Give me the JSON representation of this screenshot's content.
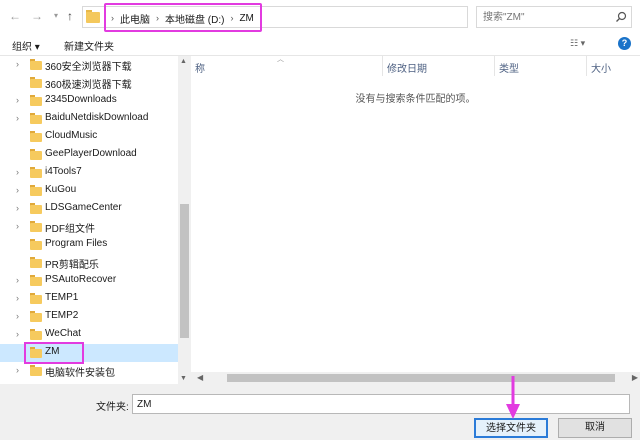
{
  "addressbar": {
    "crumbs": [
      "此电脑",
      "本地磁盘 (D:)",
      "ZM"
    ],
    "search_placeholder": "搜索\"ZM\""
  },
  "toolbar": {
    "organize_label": "组织 ▾",
    "new_folder_label": "新建文件夹"
  },
  "tree": {
    "items": [
      {
        "label": "360安全浏览器下载",
        "expandable": true
      },
      {
        "label": "360极速浏览器下载",
        "expandable": false
      },
      {
        "label": "2345Downloads",
        "expandable": true
      },
      {
        "label": "BaiduNetdiskDownload",
        "expandable": true
      },
      {
        "label": "CloudMusic",
        "expandable": false
      },
      {
        "label": "GeePlayerDownload",
        "expandable": false
      },
      {
        "label": "i4Tools7",
        "expandable": true
      },
      {
        "label": "KuGou",
        "expandable": true
      },
      {
        "label": "LDSGameCenter",
        "expandable": true
      },
      {
        "label": "PDF组文件",
        "expandable": true
      },
      {
        "label": "Program Files",
        "expandable": false
      },
      {
        "label": "PR剪辑配乐",
        "expandable": false
      },
      {
        "label": "PSAutoRecover",
        "expandable": true
      },
      {
        "label": "TEMP1",
        "expandable": true
      },
      {
        "label": "TEMP2",
        "expandable": true
      },
      {
        "label": "WeChat",
        "expandable": true
      },
      {
        "label": "ZM",
        "expandable": false,
        "selected": true
      },
      {
        "label": "电脑软件安装包",
        "expandable": true
      }
    ]
  },
  "content": {
    "columns": [
      "称",
      "修改日期",
      "类型",
      "大小"
    ],
    "empty_message": "没有与搜索条件匹配的项。"
  },
  "bottom": {
    "filename_label": "文件夹:",
    "filename_value": "ZM",
    "select_button": "选择文件夹",
    "cancel_button": "取消"
  },
  "colors": {
    "highlight": "#e23be0",
    "selection": "#cce8ff",
    "primary_button_border": "#2b7bd8",
    "folder": "#f6ca5e"
  }
}
